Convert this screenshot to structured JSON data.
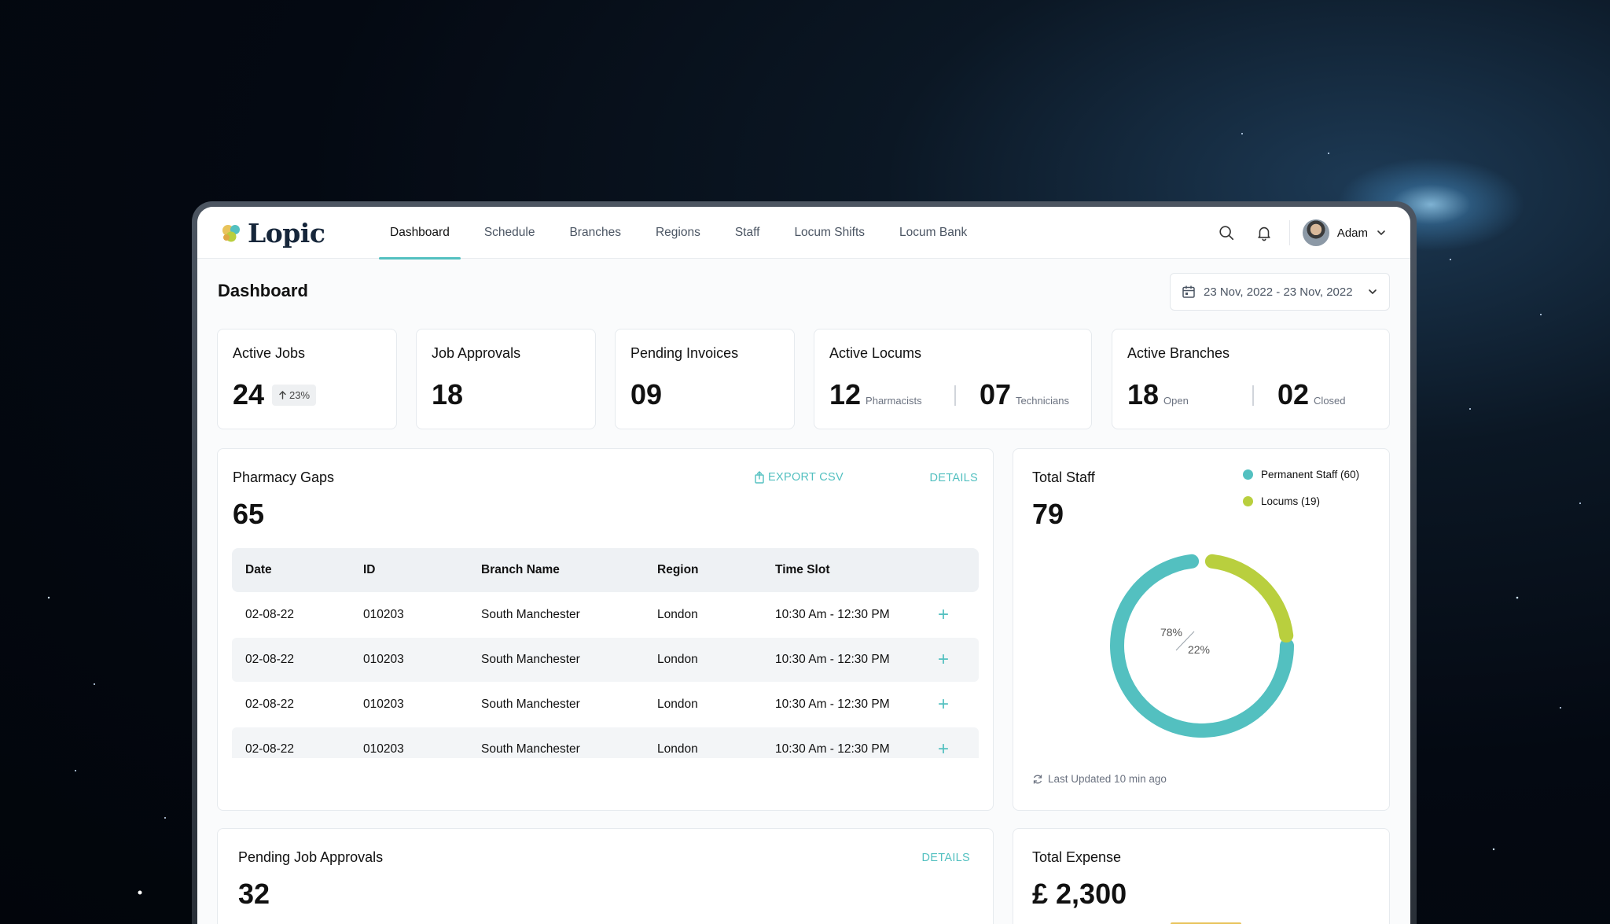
{
  "colors": {
    "accent": "#53c0c0",
    "secondary": "#b9cf3e",
    "text": "#111111",
    "muted": "#6b7280"
  },
  "brand": {
    "name": "Lopic"
  },
  "nav": {
    "items": [
      {
        "label": "Dashboard",
        "active": true
      },
      {
        "label": "Schedule"
      },
      {
        "label": "Branches"
      },
      {
        "label": "Regions"
      },
      {
        "label": "Staff"
      },
      {
        "label": "Locum Shifts"
      },
      {
        "label": "Locum Bank"
      }
    ],
    "icons": {
      "search": "search-icon",
      "notifications": "bell-icon",
      "dropdown": "chevron-down-icon"
    },
    "user": {
      "name": "Adam"
    }
  },
  "page": {
    "title": "Dashboard",
    "date_range": "23 Nov, 2022 - 23 Nov, 2022"
  },
  "stats": {
    "active_jobs": {
      "title": "Active Jobs",
      "value": "24",
      "change": "23%"
    },
    "job_approvals": {
      "title": "Job Approvals",
      "value": "18"
    },
    "pending_invoices": {
      "title": "Pending Invoices",
      "value": "09"
    },
    "active_locums": {
      "title": "Active Locums",
      "a_value": "12",
      "a_label": "Pharmacists",
      "b_value": "07",
      "b_label": "Technicians"
    },
    "active_branches": {
      "title": "Active Branches",
      "a_value": "18",
      "a_label": "Open",
      "b_value": "02",
      "b_label": "Closed"
    }
  },
  "pharmacy_gaps": {
    "title": "Pharmacy Gaps",
    "value": "65",
    "export_label": "EXPORT CSV",
    "details_label": "DETAILS",
    "columns": [
      "Date",
      "ID",
      "Branch Name",
      "Region",
      "Time Slot"
    ],
    "rows": [
      [
        "02-08-22",
        "010203",
        "South Manchester",
        "London",
        "10:30 Am - 12:30 PM"
      ],
      [
        "02-08-22",
        "010203",
        "South Manchester",
        "London",
        "10:30 Am - 12:30 PM"
      ],
      [
        "02-08-22",
        "010203",
        "South Manchester",
        "London",
        "10:30 Am - 12:30 PM"
      ],
      [
        "02-08-22",
        "010203",
        "South Manchester",
        "London",
        "10:30 Am - 12:30 PM"
      ]
    ]
  },
  "total_staff": {
    "title": "Total Staff",
    "value": "79",
    "legend": [
      {
        "label": "Permanent Staff (60)",
        "color": "#53c0c0"
      },
      {
        "label": "Locums (19)",
        "color": "#b9cf3e"
      }
    ],
    "last_updated": "Last Updated 10 min ago",
    "chart_data": {
      "type": "pie",
      "donut": true,
      "labels": [
        "Permanent Staff (60)",
        "Locums (19)"
      ],
      "values": [
        60,
        19
      ],
      "percent_labels": [
        "78%",
        "22%"
      ]
    }
  },
  "pending_job_approvals": {
    "title": "Pending Job Approvals",
    "value": "32",
    "details_label": "DETAILS"
  },
  "total_expense": {
    "title": "Total Expense",
    "value": "£ 2,300"
  }
}
